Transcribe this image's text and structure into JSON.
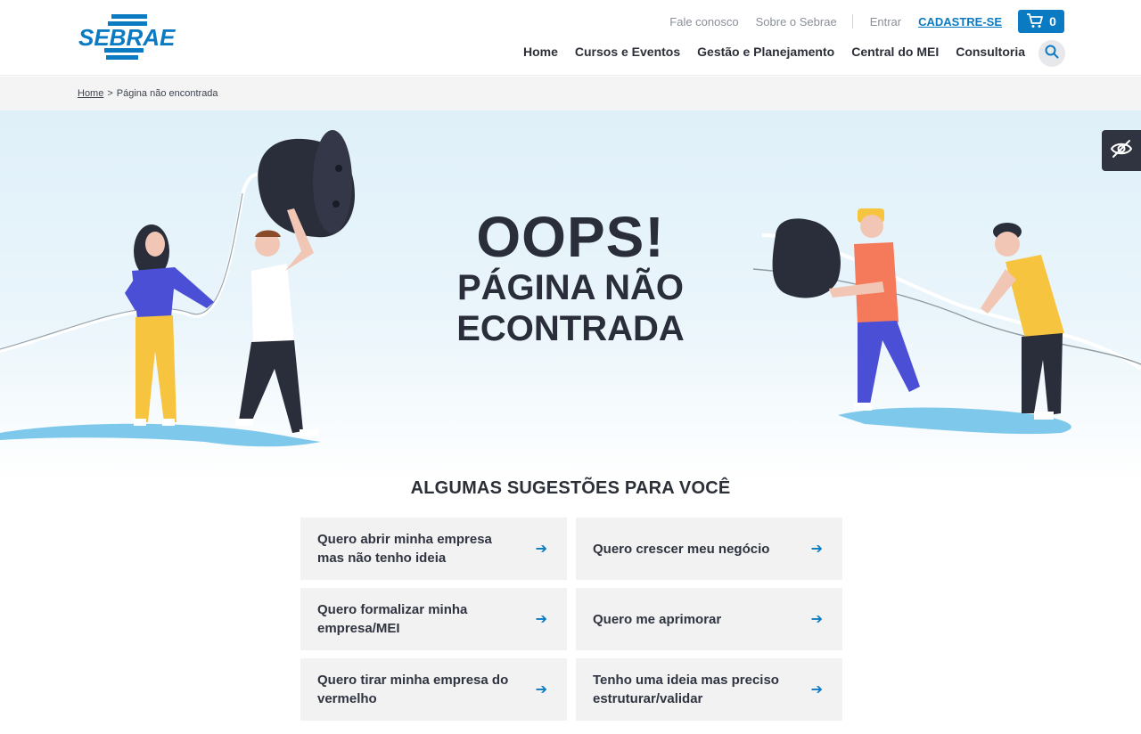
{
  "brand": {
    "logo_text": "SEBRAE",
    "accent": "#0a7bc2"
  },
  "top_links": {
    "contact": "Fale conosco",
    "about": "Sobre o Sebrae",
    "login": "Entrar",
    "register": "CADASTRE-SE",
    "cart_count": "0"
  },
  "nav": {
    "items": [
      "Home",
      "Cursos e Eventos",
      "Gestão e Planejamento",
      "Central do MEI",
      "Consultoria"
    ]
  },
  "breadcrumb": {
    "home": "Home",
    "separator": ">",
    "current": "Página não encontrada"
  },
  "hero": {
    "title": "OOPS!",
    "subtitle_line1": "PÁGINA NÃO",
    "subtitle_line2": "ECONTRADA"
  },
  "suggestions": {
    "title": "ALGUMAS SUGESTÕES PARA VOCÊ",
    "arrow": "➔",
    "items": [
      "Quero abrir minha empresa mas não tenho ideia",
      "Quero crescer meu negócio",
      "Quero formalizar minha empresa/MEI",
      "Quero me aprimorar",
      "Quero tirar minha empresa do vermelho",
      "Tenho uma ideia mas preciso estruturar/validar"
    ]
  },
  "icons": {
    "cart": "cart-icon",
    "search": "search-icon",
    "accessibility": "eye-slash-icon"
  }
}
